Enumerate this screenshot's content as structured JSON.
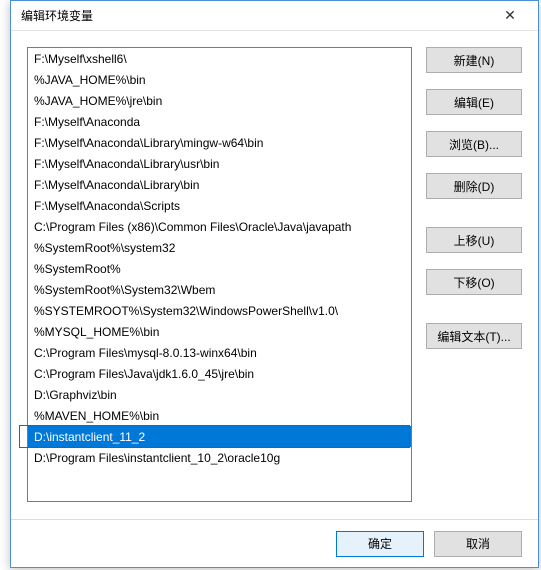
{
  "dialog": {
    "title": "编辑环境变量"
  },
  "list": {
    "items": [
      "F:\\Myself\\xshell6\\",
      "%JAVA_HOME%\\bin",
      "%JAVA_HOME%\\jre\\bin",
      "F:\\Myself\\Anaconda",
      "F:\\Myself\\Anaconda\\Library\\mingw-w64\\bin",
      "F:\\Myself\\Anaconda\\Library\\usr\\bin",
      "F:\\Myself\\Anaconda\\Library\\bin",
      "F:\\Myself\\Anaconda\\Scripts",
      "C:\\Program Files (x86)\\Common Files\\Oracle\\Java\\javapath",
      "%SystemRoot%\\system32",
      "%SystemRoot%",
      "%SystemRoot%\\System32\\Wbem",
      "%SYSTEMROOT%\\System32\\WindowsPowerShell\\v1.0\\",
      "%MYSQL_HOME%\\bin",
      "C:\\Program Files\\mysql-8.0.13-winx64\\bin",
      "C:\\Program Files\\Java\\jdk1.6.0_45\\jre\\bin",
      "D:\\Graphviz\\bin",
      "%MAVEN_HOME%\\bin",
      "D:\\instantclient_11_2",
      "D:\\Program Files\\instantclient_10_2\\oracle10g"
    ],
    "selected_index": 18
  },
  "buttons": {
    "new": "新建(N)",
    "edit": "编辑(E)",
    "browse": "浏览(B)...",
    "delete": "删除(D)",
    "move_up": "上移(U)",
    "move_down": "下移(O)",
    "edit_text": "编辑文本(T)..."
  },
  "footer": {
    "ok": "确定",
    "cancel": "取消"
  }
}
